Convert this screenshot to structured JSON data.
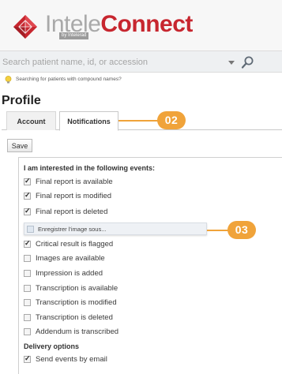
{
  "header": {
    "logo_part1": "Intele",
    "logo_part2": "Connect",
    "byline": "by Intelerad"
  },
  "search": {
    "placeholder": "Search patient name, id, or accession",
    "hint_text": "Searching for patients with compound names?"
  },
  "page": {
    "title": "Profile"
  },
  "tabs": [
    {
      "label": "Account",
      "active": false
    },
    {
      "label": "Notifications",
      "active": true
    }
  ],
  "toolbar": {
    "save_label": "Save"
  },
  "events": {
    "heading": "I am interested in the following events:",
    "items": [
      {
        "label": "Final report is available",
        "checked": true
      },
      {
        "label": "Final report is modified",
        "checked": true
      },
      {
        "label": "Final report is deleted",
        "checked": true
      },
      {
        "label": "Critical result is flagged",
        "checked": true
      },
      {
        "label": "Images are available",
        "checked": false
      },
      {
        "label": "Impression is added",
        "checked": false
      },
      {
        "label": "Transcription is available",
        "checked": false
      },
      {
        "label": "Transcription is modified",
        "checked": false
      },
      {
        "label": "Transcription is deleted",
        "checked": false
      },
      {
        "label": "Addendum is transcribed",
        "checked": false
      }
    ]
  },
  "tooltip": {
    "text": "Enregistrer l'image sous..."
  },
  "delivery": {
    "heading": "Delivery options",
    "items": [
      {
        "label": "Send events by email",
        "checked": true
      }
    ]
  },
  "callouts": [
    {
      "label": "02"
    },
    {
      "label": "03"
    }
  ],
  "colors": {
    "brand_red": "#c7262f",
    "callout_orange": "#f0a33a"
  }
}
